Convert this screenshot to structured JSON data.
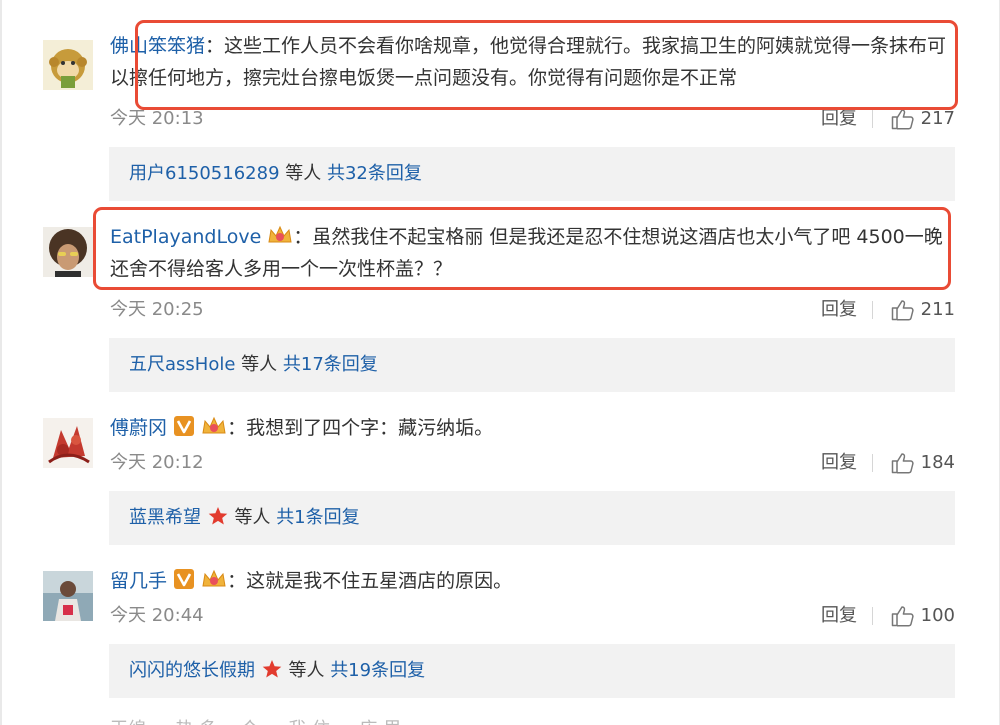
{
  "colors": {
    "link": "#1e60a8",
    "highlight": "#e94b35",
    "summary_bg": "#f2f2f2",
    "meta": "#8a8a8a"
  },
  "comments": [
    {
      "user": "佛山笨笨猪",
      "text": "：这些工作人员不会看你啥规章，他觉得合理就行。我家搞卫生的阿姨就觉得一条抹布可以擦任何地方，擦完灶台擦电饭煲一点问题没有。你觉得有问题你是不正常",
      "time": "今天 20:13",
      "reply_label": "回复",
      "likes": "217",
      "summary": {
        "who": "用户6150516289",
        "mid": " 等人 ",
        "total": "共32条回复"
      },
      "avatar_icon": "monkey-avatar"
    },
    {
      "user": "EatPlayandLove",
      "text": "：虽然我住不起宝格丽 但是我还是忍不住想说这酒店也太小气了吧 4500一晚还舍不得给客人多用一个一次性杯盖？？",
      "time": "今天 20:25",
      "reply_label": "回复",
      "likes": "211",
      "summary": {
        "who": "五尺assHole",
        "mid": " 等人 ",
        "total": "共17条回复"
      },
      "badges": [
        "crown-icon"
      ],
      "avatar_icon": "curly-hair-avatar"
    },
    {
      "user": "傅蔚冈",
      "text": "：我想到了四个字：藏污纳垢。",
      "time": "今天 20:12",
      "reply_label": "回复",
      "likes": "184",
      "summary": {
        "who": "蓝黑希望",
        "mid": " 等人 ",
        "total": "共1条回复"
      },
      "badges": [
        "verified-v-icon",
        "crown-icon"
      ],
      "avatar_icon": "red-pattern-avatar"
    },
    {
      "user": "留几手",
      "text": "：这就是我不住五星酒店的原因。",
      "time": "今天 20:44",
      "reply_label": "回复",
      "likes": "100",
      "summary": {
        "who": "闪闪的悠长假期",
        "mid": " 等人 ",
        "total": "共19条回复"
      },
      "badges": [
        "verified-v-icon",
        "crown-icon"
      ],
      "avatar_icon": "person-photo-avatar"
    }
  ],
  "partial_next": "王绵 … 热 多 一个 … 我 住 … 店 里"
}
